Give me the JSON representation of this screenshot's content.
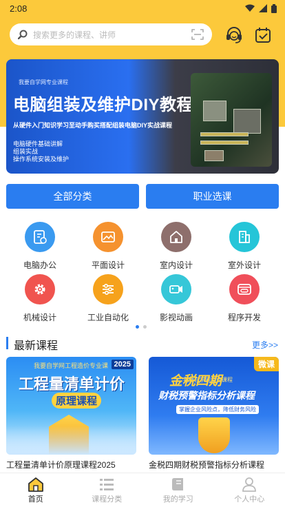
{
  "status": {
    "time": "2:08"
  },
  "search": {
    "placeholder": "搜索更多的课程、讲师"
  },
  "banner": {
    "small": "我要自学网专业课程",
    "title": "电脑组装及维护DIY教程",
    "subtitle": "从硬件入门知识学习至动手购买搭配组装电脑DIY实战课程",
    "points": [
      "电脑硬件基础讲解",
      "组装实战",
      "操作系统安装及维护"
    ]
  },
  "categories": {
    "all": "全部分类",
    "career": "职业选课"
  },
  "grid": [
    {
      "label": "电脑办公",
      "color": "#3a9af0",
      "icon": "office-icon"
    },
    {
      "label": "平面设计",
      "color": "#f5922f",
      "icon": "image-icon"
    },
    {
      "label": "室内设计",
      "color": "#8e6f6c",
      "icon": "house-icon"
    },
    {
      "label": "室外设计",
      "color": "#25c5d8",
      "icon": "building-icon"
    },
    {
      "label": "机械设计",
      "color": "#f0544f",
      "icon": "gear-icon"
    },
    {
      "label": "工业自动化",
      "color": "#f6a21c",
      "icon": "sliders-icon"
    },
    {
      "label": "影视动画",
      "color": "#36c7d8",
      "icon": "camera-icon"
    },
    {
      "label": "程序开发",
      "color": "#f04f5a",
      "icon": "code-icon"
    }
  ],
  "section": {
    "title": "最新课程",
    "more": "更多>>"
  },
  "courses": [
    {
      "name": "工程量清单计价原理课程2025",
      "thumb_title": "工程量清单计价",
      "thumb_sub": "原理课程",
      "year": "2025",
      "top_text": "我要自学网工程造价专业课"
    },
    {
      "name": "金税四期财税预警指标分析课程",
      "thumb_title": "金税四期",
      "thumb_sub": "财税预警指标分析课程",
      "badge": "微课",
      "top_text": "我要自学网专业课程",
      "note": "掌握企业风险点，降低财务风险"
    }
  ],
  "tabs": [
    {
      "label": "首页",
      "icon": "home-icon",
      "active": true
    },
    {
      "label": "课程分类",
      "icon": "list-icon"
    },
    {
      "label": "我的学习",
      "icon": "book-icon"
    },
    {
      "label": "个人中心",
      "icon": "user-icon"
    }
  ],
  "colors": {
    "brand": "#fcc93b",
    "accent": "#2a7df0"
  }
}
